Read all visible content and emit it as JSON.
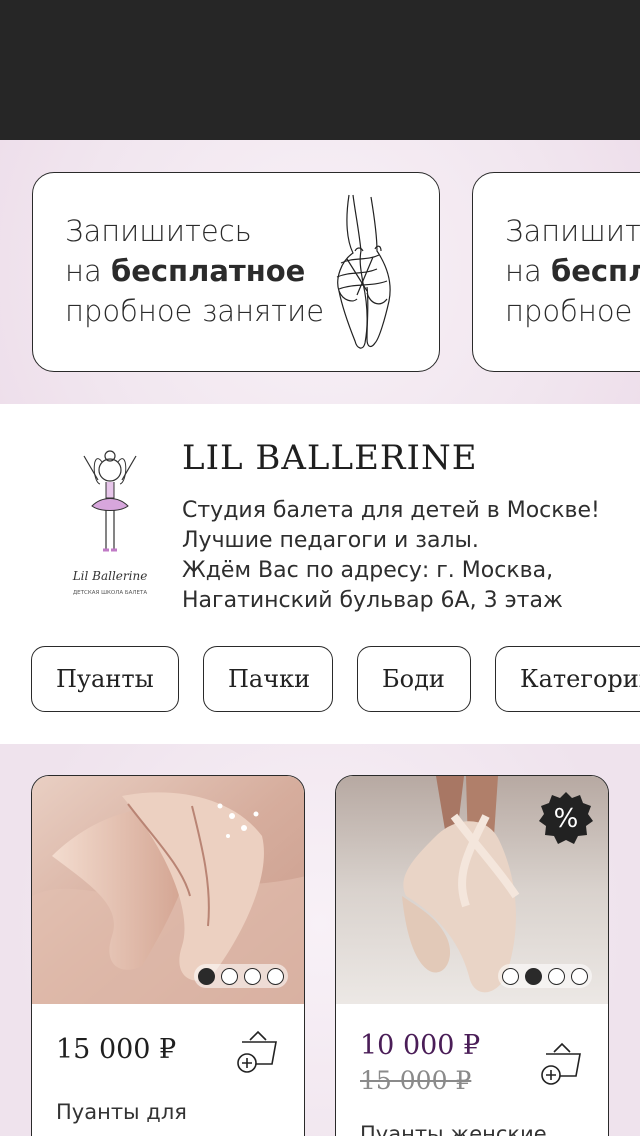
{
  "banners": [
    {
      "line1": "Запишитесь",
      "line2_prefix": "на ",
      "line2_bold": "бесплатное",
      "line3": "пробное занятие",
      "art_icon": "pointe-shoes-sketch"
    },
    {
      "line1": "Запишитесь",
      "line2_prefix": "на ",
      "line2_bold": "бесплатное",
      "line3": "пробное занятие",
      "art_icon": "pointe-shoes-sketch"
    }
  ],
  "studio": {
    "logo_icon": "ballerina-logo",
    "logo_text": "Lil Ballerine",
    "logo_subtext": "ДЕТСКАЯ ШКОЛА БАЛЕТА",
    "name": "LIL BALLERINE",
    "description": [
      "Студия балета для детей в Москве!",
      "Лучшие педагоги и залы.",
      "Ждём Вас по адресу: г. Москва,",
      "Нагатинский бульвар 6А, 3 этаж"
    ]
  },
  "categories": [
    "Пуанты",
    "Пачки",
    "Боди",
    "Категории"
  ],
  "products": [
    {
      "price": "15 000 ₽",
      "old_price": "",
      "name": "Пуанты для",
      "on_sale": false,
      "photo_index": 1,
      "photo_count": 4,
      "cart_icon": "add-to-basket-icon"
    },
    {
      "price": "10 000 ₽",
      "old_price": "15 000 ₽",
      "name": "Пуанты женские",
      "on_sale": true,
      "discount_icon": "percent-badge-icon",
      "photo_index": 2,
      "photo_count": 4,
      "cart_icon": "add-to-basket-icon"
    }
  ],
  "colors": {
    "status_bar": "#262626",
    "sale_price": "#4a1d57",
    "border": "#2a2a2a",
    "background": "#f6eef5"
  }
}
